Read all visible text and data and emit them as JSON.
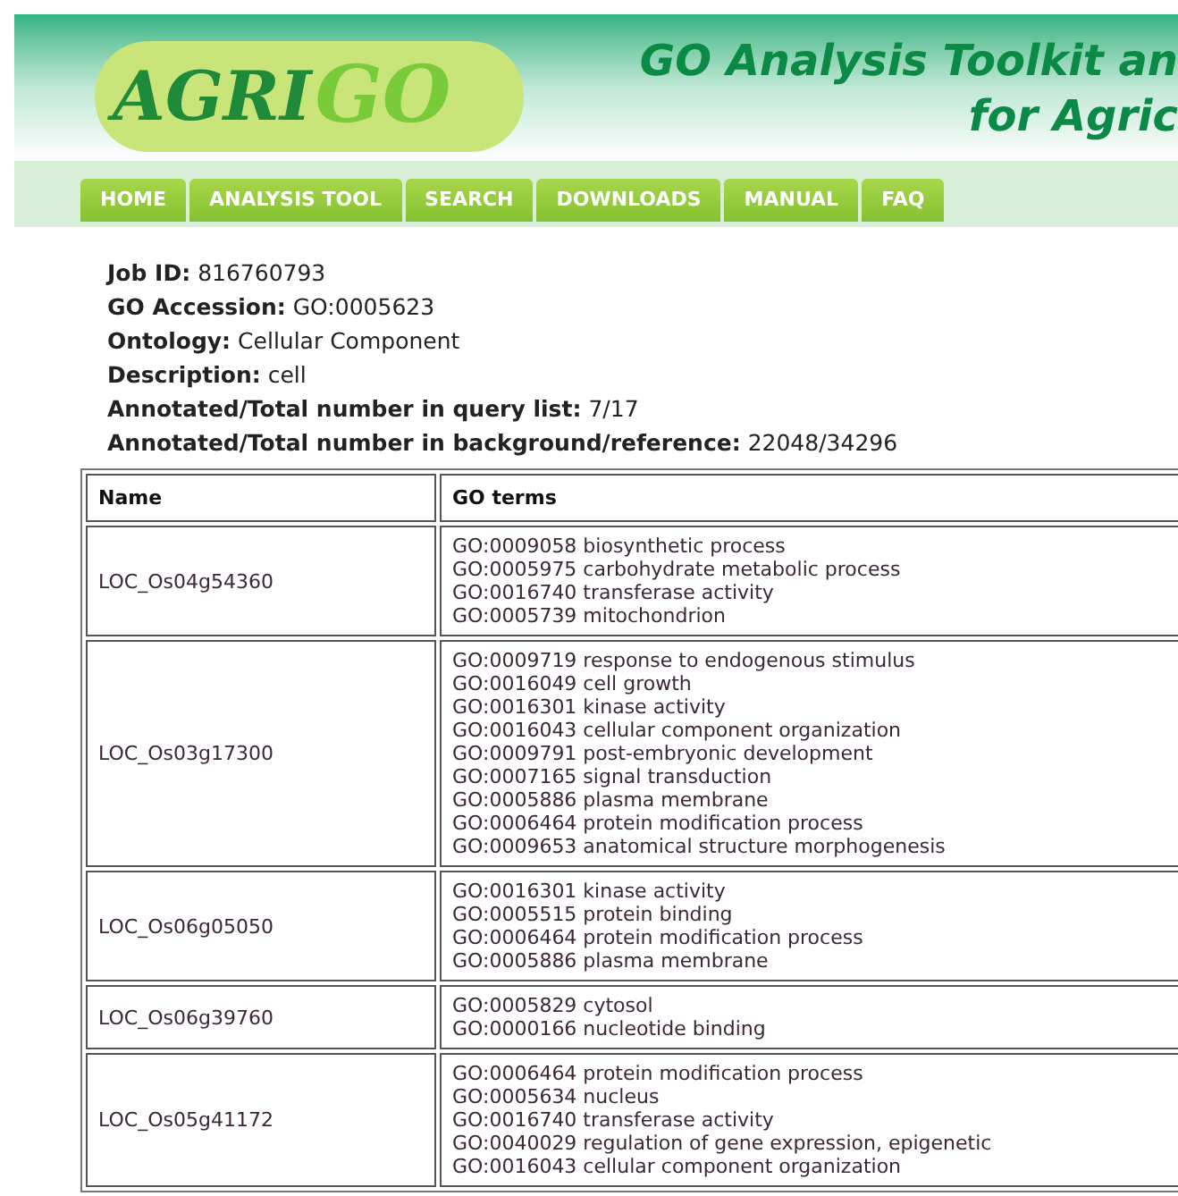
{
  "header": {
    "logo_left": "AGRI",
    "logo_right": "GO",
    "title_line_1": "GO Analysis Toolkit an",
    "title_line_2": "for Agric"
  },
  "nav": [
    "HOME",
    "ANALYSIS TOOL",
    "SEARCH",
    "DOWNLOADS",
    "MANUAL",
    "FAQ"
  ],
  "info": [
    {
      "label": "Job ID:",
      "value": "816760793"
    },
    {
      "label": "GO Accession:",
      "value": "GO:0005623"
    },
    {
      "label": "Ontology:",
      "value": "Cellular Component"
    },
    {
      "label": "Description:",
      "value": "cell"
    },
    {
      "label": "Annotated/Total number in query list:",
      "value": "7/17"
    },
    {
      "label": "Annotated/Total number in background/reference:",
      "value": "22048/34296"
    }
  ],
  "table": {
    "columns": [
      "Name",
      "GO terms"
    ],
    "rows": [
      {
        "name": "LOC_Os04g54360",
        "terms": [
          "GO:0009058 biosynthetic process",
          "GO:0005975 carbohydrate metabolic process",
          "GO:0016740 transferase activity",
          "GO:0005739 mitochondrion"
        ]
      },
      {
        "name": "LOC_Os03g17300",
        "terms": [
          "GO:0009719 response to endogenous stimulus",
          "GO:0016049 cell growth",
          "GO:0016301 kinase activity",
          "GO:0016043 cellular component organization",
          "GO:0009791 post-embryonic development",
          "GO:0007165 signal transduction",
          "GO:0005886 plasma membrane",
          "GO:0006464 protein modification process",
          "GO:0009653 anatomical structure morphogenesis"
        ]
      },
      {
        "name": "LOC_Os06g05050",
        "terms": [
          "GO:0016301 kinase activity",
          "GO:0005515 protein binding",
          "GO:0006464 protein modification process",
          "GO:0005886 plasma membrane"
        ]
      },
      {
        "name": "LOC_Os06g39760",
        "terms": [
          "GO:0005829 cytosol",
          "GO:0000166 nucleotide binding"
        ]
      },
      {
        "name": "LOC_Os05g41172",
        "terms": [
          "GO:0006464 protein modification process",
          "GO:0005634 nucleus",
          "GO:0016740 transferase activity",
          "GO:0040029 regulation of gene expression, epigenetic",
          "GO:0016043 cellular component organization"
        ]
      }
    ]
  }
}
